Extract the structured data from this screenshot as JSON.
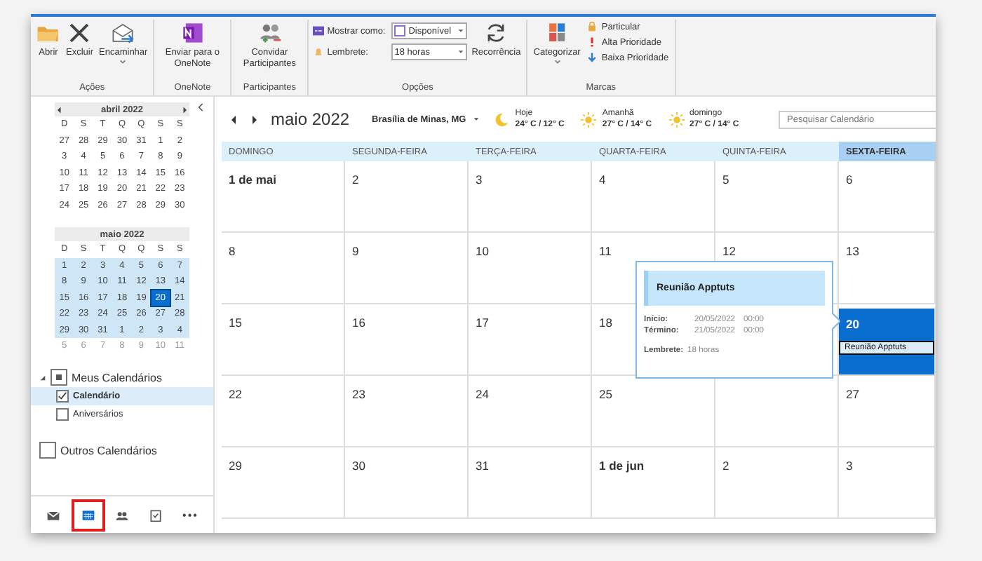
{
  "ribbon": {
    "groups": [
      {
        "label": "Ações",
        "items": [
          {
            "kind": "large",
            "label": "Abrir"
          },
          {
            "kind": "large",
            "label": "Excluir"
          },
          {
            "kind": "large",
            "label": "Encaminhar",
            "dropdown": true
          }
        ]
      },
      {
        "label": "OneNote",
        "items": [
          {
            "kind": "large",
            "label": "Enviar para o OneNote"
          }
        ]
      },
      {
        "label": "Participantes",
        "items": [
          {
            "kind": "large",
            "label": "Convidar Participantes"
          }
        ]
      },
      {
        "label": "Opções",
        "items": [
          {
            "kind": "fields",
            "rows": [
              {
                "label": "Mostrar como:",
                "value": "Disponível",
                "swatch": true
              },
              {
                "label": "Lembrete:",
                "value": "18 horas"
              }
            ]
          },
          {
            "kind": "large",
            "label": "Recorrência"
          }
        ]
      },
      {
        "label": "Marcas",
        "items": [
          {
            "kind": "large",
            "label": "Categorizar",
            "dropdown": true
          },
          {
            "kind": "small",
            "rows": [
              {
                "label": "Particular"
              },
              {
                "label": "Alta Prioridade"
              },
              {
                "label": "Baixa Prioridade"
              }
            ]
          }
        ]
      }
    ]
  },
  "sidebar": {
    "mini_calendars": [
      {
        "title": "abril 2022",
        "arrows": true,
        "weekdays": [
          "D",
          "S",
          "T",
          "Q",
          "Q",
          "S",
          "S"
        ],
        "weeks": [
          {
            "in_view": false,
            "other_month": false,
            "days": [
              {
                "t": "27",
                "selected": false
              },
              {
                "t": "28",
                "selected": false
              },
              {
                "t": "29",
                "selected": false
              },
              {
                "t": "30",
                "selected": false
              },
              {
                "t": "31",
                "selected": false
              },
              {
                "t": "1",
                "selected": false
              },
              {
                "t": "2",
                "selected": false
              }
            ]
          },
          {
            "in_view": false,
            "other_month": false,
            "days": [
              {
                "t": "3",
                "selected": false
              },
              {
                "t": "4",
                "selected": false
              },
              {
                "t": "5",
                "selected": false
              },
              {
                "t": "6",
                "selected": false
              },
              {
                "t": "7",
                "selected": false
              },
              {
                "t": "8",
                "selected": false
              },
              {
                "t": "9",
                "selected": false
              }
            ]
          },
          {
            "in_view": false,
            "other_month": false,
            "days": [
              {
                "t": "10",
                "selected": false
              },
              {
                "t": "11",
                "selected": false
              },
              {
                "t": "12",
                "selected": false
              },
              {
                "t": "13",
                "selected": false
              },
              {
                "t": "14",
                "selected": false
              },
              {
                "t": "15",
                "selected": false
              },
              {
                "t": "16",
                "selected": false
              }
            ]
          },
          {
            "in_view": false,
            "other_month": false,
            "days": [
              {
                "t": "17",
                "selected": false
              },
              {
                "t": "18",
                "selected": false
              },
              {
                "t": "19",
                "selected": false
              },
              {
                "t": "20",
                "selected": false
              },
              {
                "t": "21",
                "selected": false
              },
              {
                "t": "22",
                "selected": false
              },
              {
                "t": "23",
                "selected": false
              }
            ]
          },
          {
            "in_view": false,
            "other_month": false,
            "days": [
              {
                "t": "24",
                "selected": false
              },
              {
                "t": "25",
                "selected": false
              },
              {
                "t": "26",
                "selected": false
              },
              {
                "t": "27",
                "selected": false
              },
              {
                "t": "28",
                "selected": false
              },
              {
                "t": "29",
                "selected": false
              },
              {
                "t": "30",
                "selected": false
              }
            ]
          }
        ]
      },
      {
        "title": "maio 2022",
        "arrows": false,
        "weekdays": [
          "D",
          "S",
          "T",
          "Q",
          "Q",
          "S",
          "S"
        ],
        "weeks": [
          {
            "in_view": true,
            "other_month": false,
            "days": [
              {
                "t": "1",
                "selected": false
              },
              {
                "t": "2",
                "selected": false
              },
              {
                "t": "3",
                "selected": false
              },
              {
                "t": "4",
                "selected": false
              },
              {
                "t": "5",
                "selected": false
              },
              {
                "t": "6",
                "selected": false
              },
              {
                "t": "7",
                "selected": false
              }
            ]
          },
          {
            "in_view": true,
            "other_month": false,
            "days": [
              {
                "t": "8",
                "selected": false
              },
              {
                "t": "9",
                "selected": false
              },
              {
                "t": "10",
                "selected": false
              },
              {
                "t": "11",
                "selected": false
              },
              {
                "t": "12",
                "selected": false
              },
              {
                "t": "13",
                "selected": false
              },
              {
                "t": "14",
                "selected": false
              }
            ]
          },
          {
            "in_view": true,
            "other_month": false,
            "days": [
              {
                "t": "15",
                "selected": false
              },
              {
                "t": "16",
                "selected": false
              },
              {
                "t": "17",
                "selected": false
              },
              {
                "t": "18",
                "selected": false
              },
              {
                "t": "19",
                "selected": false
              },
              {
                "t": "20",
                "selected": true
              },
              {
                "t": "21",
                "selected": false
              }
            ]
          },
          {
            "in_view": true,
            "other_month": false,
            "days": [
              {
                "t": "22",
                "selected": false
              },
              {
                "t": "23",
                "selected": false
              },
              {
                "t": "24",
                "selected": false
              },
              {
                "t": "25",
                "selected": false
              },
              {
                "t": "26",
                "selected": false
              },
              {
                "t": "27",
                "selected": false
              },
              {
                "t": "28",
                "selected": false
              }
            ]
          },
          {
            "in_view": true,
            "other_month": false,
            "days": [
              {
                "t": "29",
                "selected": false
              },
              {
                "t": "30",
                "selected": false
              },
              {
                "t": "31",
                "selected": false
              },
              {
                "t": "1",
                "selected": false
              },
              {
                "t": "2",
                "selected": false
              },
              {
                "t": "3",
                "selected": false
              },
              {
                "t": "4",
                "selected": false
              }
            ]
          },
          {
            "in_view": false,
            "other_month": true,
            "days": [
              {
                "t": "5",
                "selected": false
              },
              {
                "t": "6",
                "selected": false
              },
              {
                "t": "7",
                "selected": false
              },
              {
                "t": "8",
                "selected": false
              },
              {
                "t": "9",
                "selected": false
              },
              {
                "t": "10",
                "selected": false
              },
              {
                "t": "11",
                "selected": false
              }
            ]
          }
        ]
      }
    ],
    "calendar_groups": [
      {
        "label": "Meus Calendários",
        "expanded": true,
        "checked": true,
        "items": [
          {
            "label": "Calendário",
            "checked": true,
            "selected": true
          },
          {
            "label": "Aniversários",
            "checked": false,
            "selected": false
          }
        ]
      },
      {
        "label": "Outros Calendários",
        "checked": false
      }
    ],
    "nav": [
      {
        "selected": false,
        "highlighted": false
      },
      {
        "selected": true,
        "highlighted": true
      },
      {
        "selected": false,
        "highlighted": false
      },
      {
        "selected": false,
        "highlighted": false
      },
      {
        "label": "•••",
        "selected": false,
        "highlighted": false
      }
    ]
  },
  "calendar": {
    "title": "maio 2022",
    "location": "Brasília de Minas, MG",
    "weather": [
      {
        "day": "Hoje",
        "temps": "24° C / 12° C"
      },
      {
        "day": "Amanhã",
        "temps": "27° C / 14° C"
      },
      {
        "day": "domingo",
        "temps": "27° C / 14° C"
      }
    ],
    "search": {
      "placeholder": "Pesquisar Calendário"
    },
    "day_headers": [
      {
        "label": "DOMINGO",
        "selected": false
      },
      {
        "label": "SEGUNDA-FEIRA",
        "selected": false
      },
      {
        "label": "TERÇA-FEIRA",
        "selected": false
      },
      {
        "label": "QUARTA-FEIRA",
        "selected": false
      },
      {
        "label": "QUINTA-FEIRA",
        "selected": false
      },
      {
        "label": "SEXTA-FEIRA",
        "selected": true
      }
    ],
    "weeks": [
      [
        {
          "label": "1 de mai",
          "bold": true,
          "selected": false
        },
        {
          "label": "2",
          "bold": false,
          "selected": false
        },
        {
          "label": "3",
          "bold": false,
          "selected": false
        },
        {
          "label": "4",
          "bold": false,
          "selected": false
        },
        {
          "label": "5",
          "bold": false,
          "selected": false
        },
        {
          "label": "6",
          "bold": false,
          "selected": false
        }
      ],
      [
        {
          "label": "8",
          "bold": false,
          "selected": false
        },
        {
          "label": "9",
          "bold": false,
          "selected": false
        },
        {
          "label": "10",
          "bold": false,
          "selected": false
        },
        {
          "label": "11",
          "bold": false,
          "selected": false
        },
        {
          "label": "12",
          "bold": false,
          "selected": false
        },
        {
          "label": "13",
          "bold": false,
          "selected": false
        }
      ],
      [
        {
          "label": "15",
          "bold": false,
          "selected": false
        },
        {
          "label": "16",
          "bold": false,
          "selected": false
        },
        {
          "label": "17",
          "bold": false,
          "selected": false
        },
        {
          "label": "18",
          "bold": false,
          "selected": false
        },
        {
          "selected": false
        },
        {
          "label": "20",
          "bold": false,
          "selected": true,
          "events": [
            {
              "title": "Reunião Apptuts"
            }
          ]
        }
      ],
      [
        {
          "label": "22",
          "bold": false,
          "selected": false
        },
        {
          "label": "23",
          "bold": false,
          "selected": false
        },
        {
          "label": "24",
          "bold": false,
          "selected": false
        },
        {
          "label": "25",
          "bold": false,
          "selected": false
        },
        {
          "selected": false
        },
        {
          "label": "27",
          "bold": false,
          "selected": false
        }
      ],
      [
        {
          "label": "29",
          "bold": false,
          "selected": false
        },
        {
          "label": "30",
          "bold": false,
          "selected": false
        },
        {
          "label": "31",
          "bold": false,
          "selected": false
        },
        {
          "label": "1 de jun",
          "bold": true,
          "selected": false
        },
        {
          "label": "2",
          "bold": false,
          "selected": false
        },
        {
          "label": "3",
          "bold": false,
          "selected": false
        }
      ]
    ],
    "popup": {
      "title": "Reunião Apptuts",
      "rows": [
        {
          "label": "Início:",
          "date": "20/05/2022",
          "time": "00:00"
        },
        {
          "label": "Término:",
          "date": "21/05/2022",
          "time": "00:00"
        }
      ],
      "reminder": {
        "label": "Lembrete:",
        "value": "18 horas"
      }
    }
  }
}
